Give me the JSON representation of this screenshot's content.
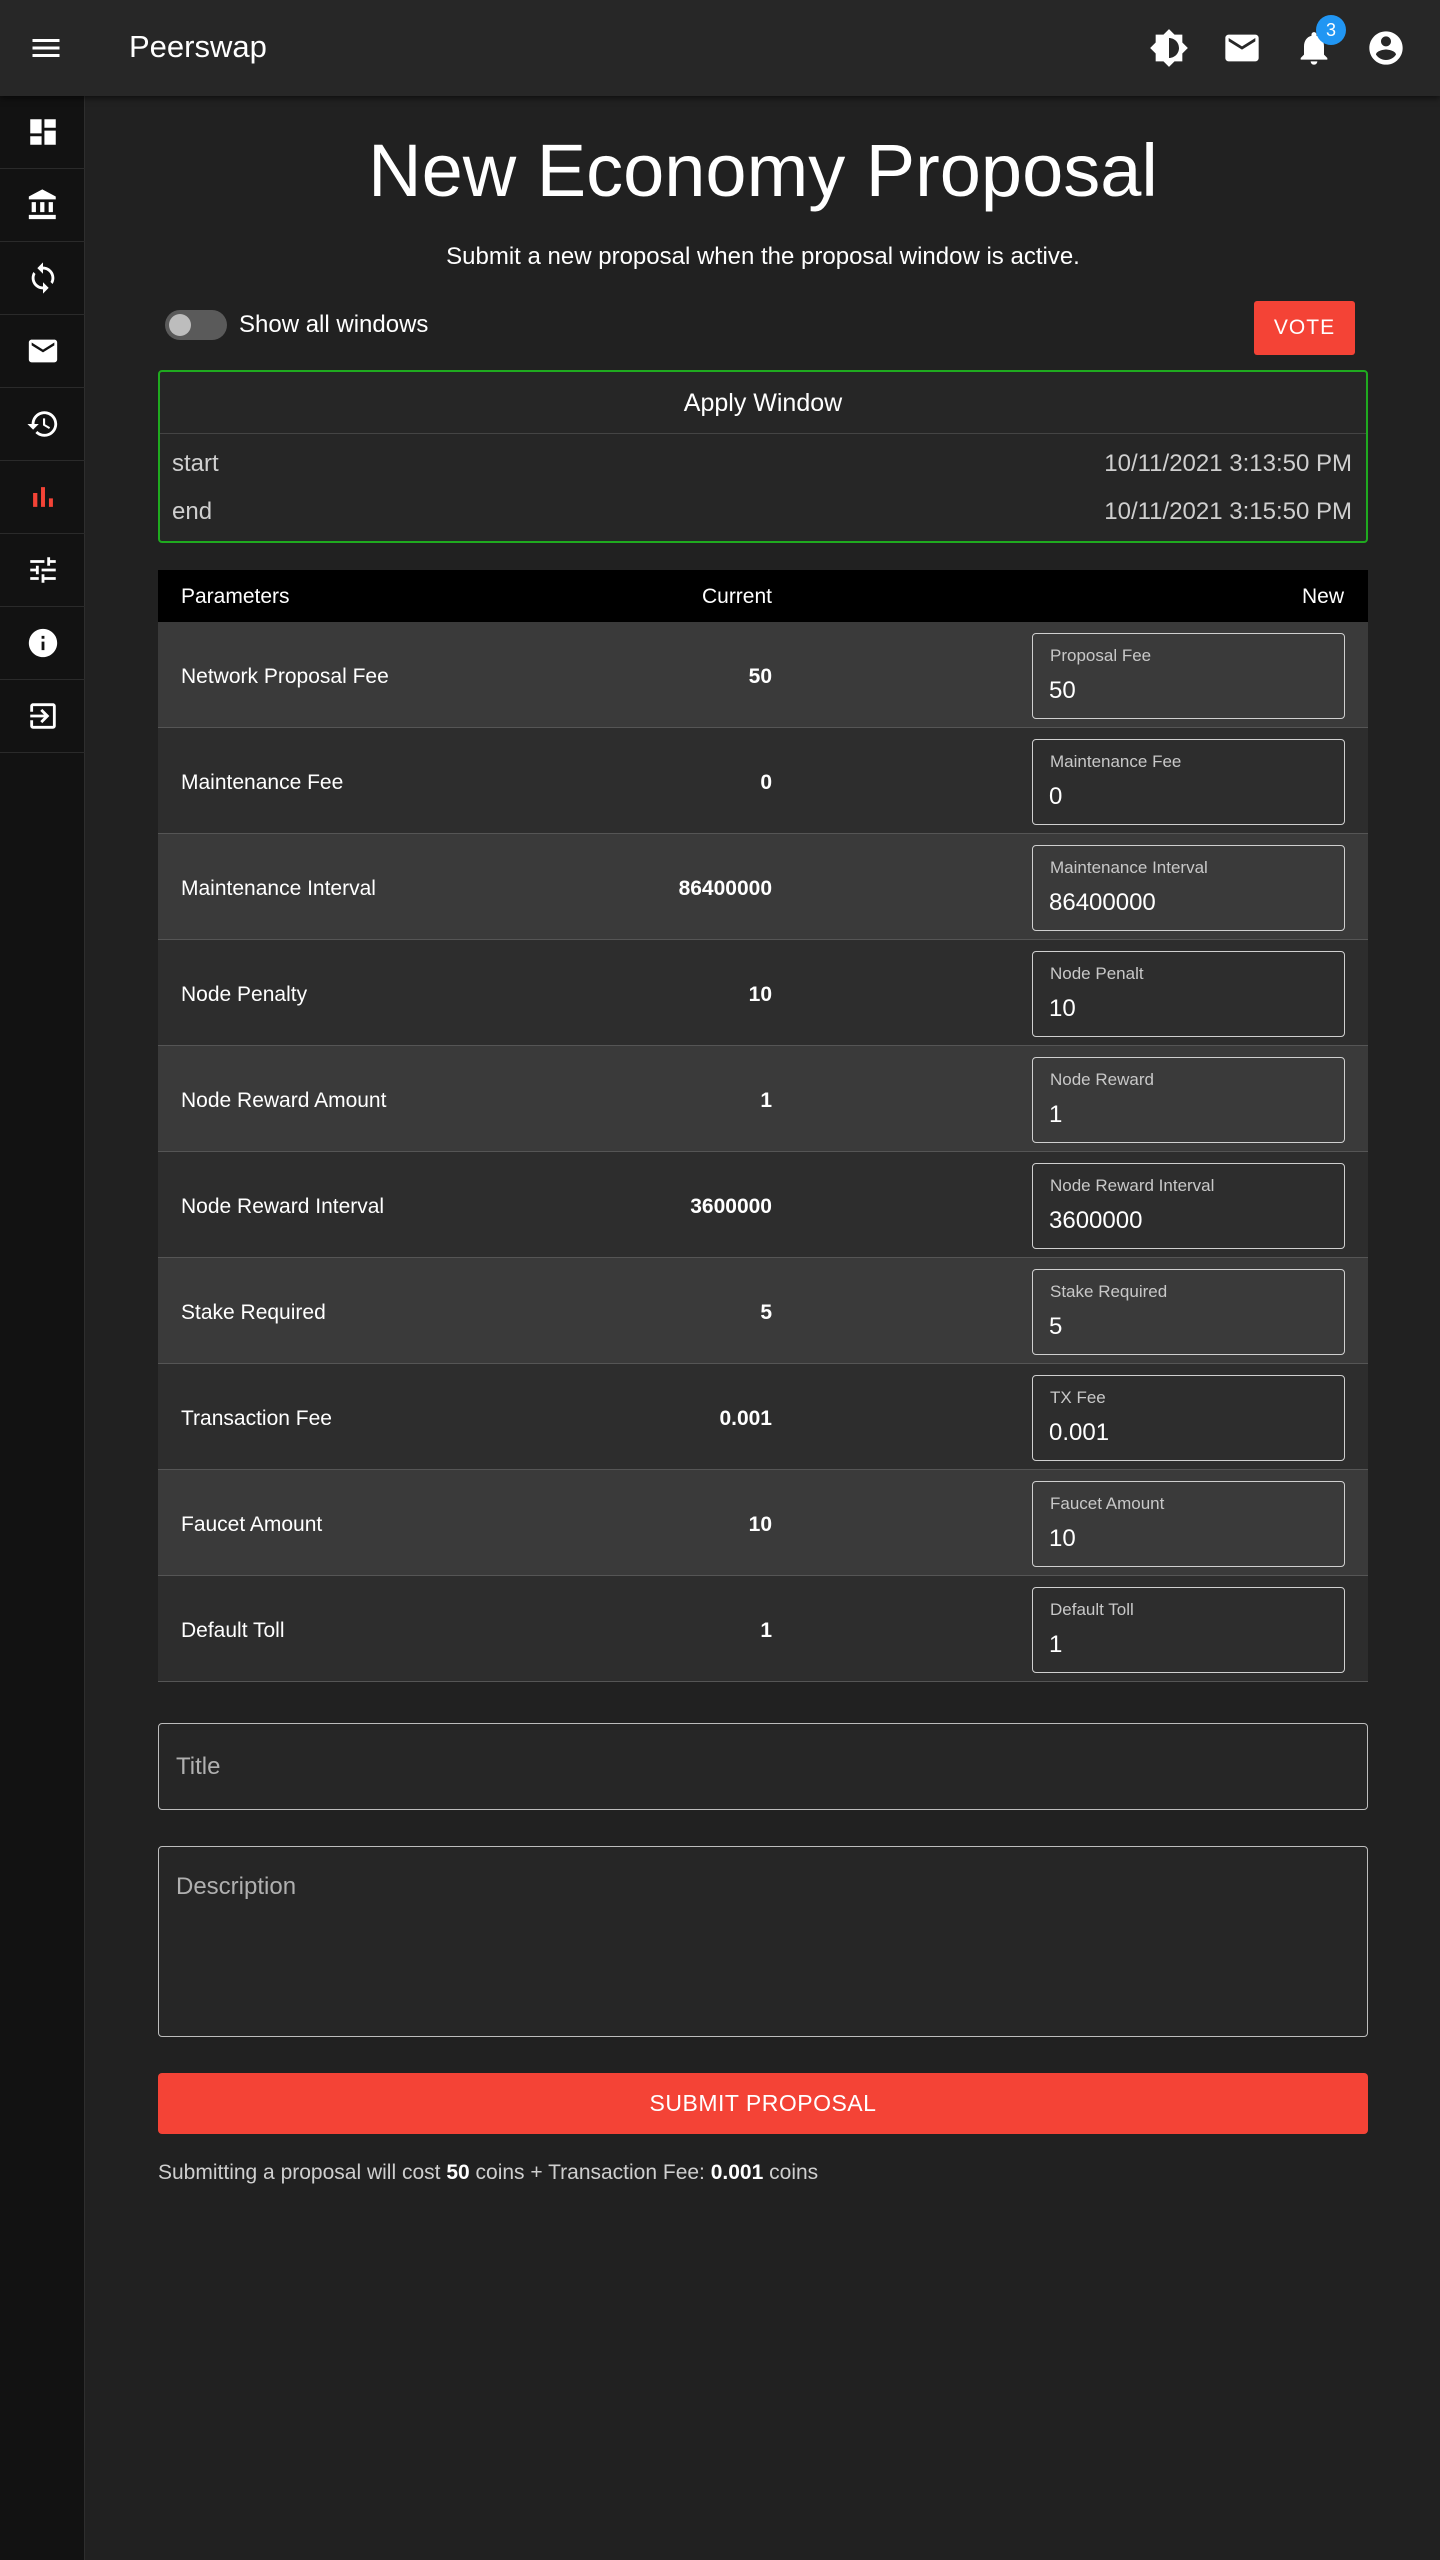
{
  "app": {
    "title": "Peerswap",
    "notification_count": "3",
    "accent_color": "#f44336",
    "badge_color": "#2196f3",
    "window_border_color": "#1faa1f"
  },
  "sidebar": {
    "items": [
      {
        "icon": "dashboard-icon",
        "active": false
      },
      {
        "icon": "bank-icon",
        "active": false
      },
      {
        "icon": "sync-icon",
        "active": false
      },
      {
        "icon": "mail-icon",
        "active": false
      },
      {
        "icon": "history-icon",
        "active": false
      },
      {
        "icon": "bar-chart-icon",
        "active": true
      },
      {
        "icon": "tune-icon",
        "active": false
      },
      {
        "icon": "info-icon",
        "active": false
      },
      {
        "icon": "logout-icon",
        "active": false
      }
    ]
  },
  "page": {
    "title": "New Economy Proposal",
    "subtitle": "Submit a new proposal when the proposal window is active."
  },
  "controls": {
    "toggle_label": "Show all windows",
    "toggle_on": false,
    "vote_label": "VOTE"
  },
  "apply_window": {
    "title": "Apply Window",
    "start_label": "start",
    "start_value": "10/11/2021 3:13:50 PM",
    "end_label": "end",
    "end_value": "10/11/2021 3:15:50 PM"
  },
  "table": {
    "headers": {
      "parameters": "Parameters",
      "current": "Current",
      "new": "New"
    },
    "rows": [
      {
        "name": "Network Proposal Fee",
        "current": "50",
        "field_label": "Proposal Fee",
        "value": "50"
      },
      {
        "name": "Maintenance Fee",
        "current": "0",
        "field_label": "Maintenance Fee",
        "value": "0"
      },
      {
        "name": "Maintenance Interval",
        "current": "86400000",
        "field_label": "Maintenance Interval",
        "value": "86400000"
      },
      {
        "name": "Node Penalty",
        "current": "10",
        "field_label": "Node Penalt",
        "value": "10"
      },
      {
        "name": "Node Reward Amount",
        "current": "1",
        "field_label": "Node Reward",
        "value": "1"
      },
      {
        "name": "Node Reward Interval",
        "current": "3600000",
        "field_label": "Node Reward Interval",
        "value": "3600000"
      },
      {
        "name": "Stake Required",
        "current": "5",
        "field_label": "Stake Required",
        "value": "5"
      },
      {
        "name": "Transaction Fee",
        "current": "0.001",
        "field_label": "TX Fee",
        "value": "0.001"
      },
      {
        "name": "Faucet Amount",
        "current": "10",
        "field_label": "Faucet Amount",
        "value": "10"
      },
      {
        "name": "Default Toll",
        "current": "1",
        "field_label": "Default Toll",
        "value": "1"
      }
    ]
  },
  "form": {
    "title_placeholder": "Title",
    "title_value": "",
    "description_placeholder": "Description",
    "description_value": "",
    "submit_label": "SUBMIT PROPOSAL"
  },
  "cost": {
    "prefix": "Submitting a proposal will cost",
    "coins": "50",
    "middle": "coins + Transaction Fee:",
    "fee": "0.001",
    "suffix": "coins"
  }
}
